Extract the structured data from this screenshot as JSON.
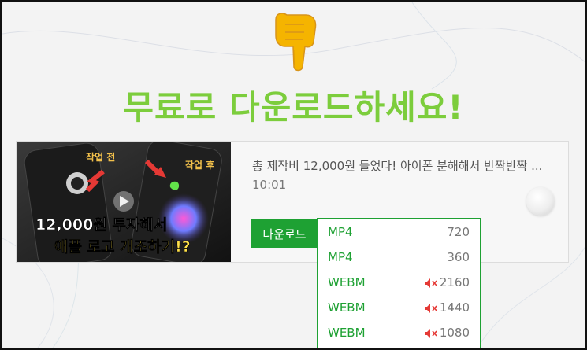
{
  "headline": "무료로 다운로드하세요!",
  "pointer_icon": "pointing-down-hand-emoji",
  "video": {
    "title": "총 제작비 12,000원 들었다! 아이폰 분해해서 반짝반짝 ...",
    "duration": "10:01",
    "thumbnail": {
      "label_before": "작업 전",
      "label_after": "작업 후",
      "caption_line1": "12,000원 투자해서",
      "caption_line2": "애플 로고 개조하기!?"
    }
  },
  "download_button": {
    "label": "다운로드"
  },
  "formats": [
    {
      "format": "MP4",
      "quality": "720",
      "muted": false
    },
    {
      "format": "MP4",
      "quality": "360",
      "muted": false
    },
    {
      "format": "WEBM",
      "quality": "2160",
      "muted": true
    },
    {
      "format": "WEBM",
      "quality": "1440",
      "muted": true
    },
    {
      "format": "WEBM",
      "quality": "1080",
      "muted": true
    }
  ],
  "colors": {
    "accent_green": "#1ea133",
    "headline_green": "#7ccd3c",
    "mute_red": "#e53935"
  }
}
